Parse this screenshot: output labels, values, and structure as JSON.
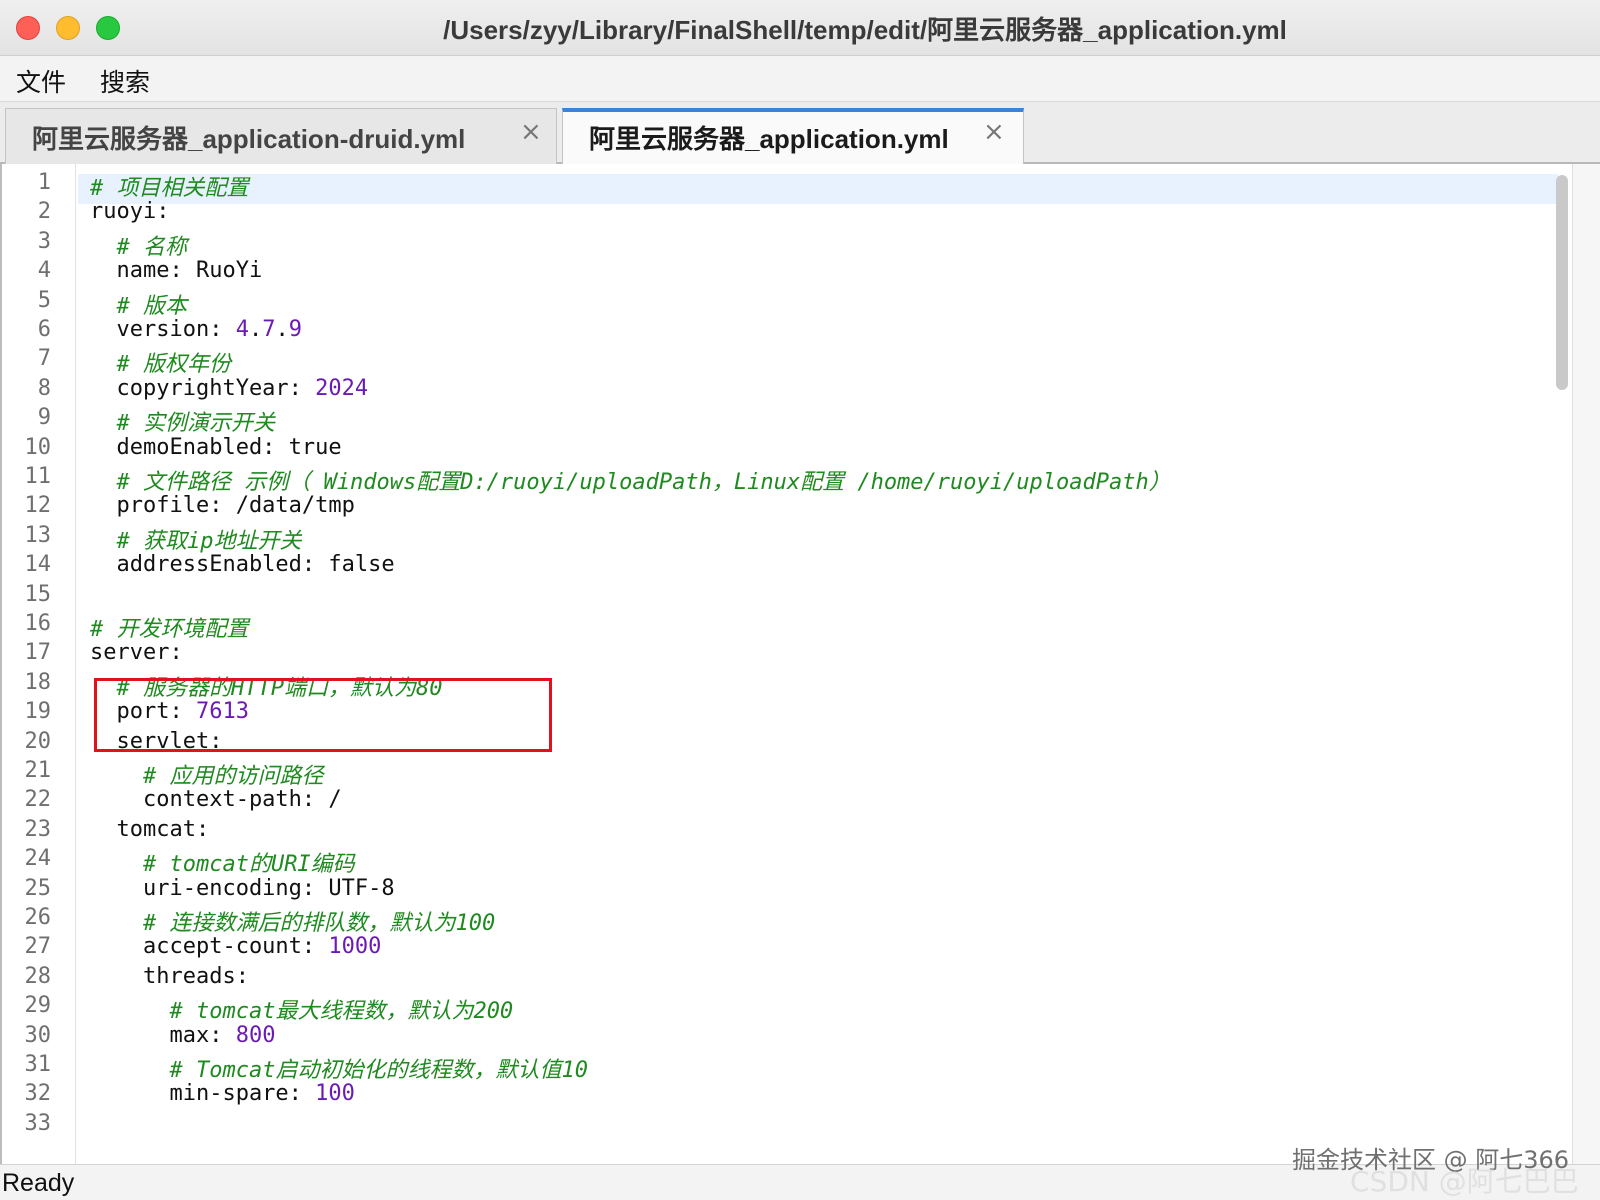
{
  "window": {
    "title": "/Users/zyy/Library/FinalShell/temp/edit/阿里云服务器_application.yml"
  },
  "menu": {
    "items": [
      "文件",
      "搜索"
    ]
  },
  "tabs": [
    {
      "label": "阿里云服务器_application-druid.yml",
      "close": "×",
      "active": false
    },
    {
      "label": "阿里云服务器_application.yml",
      "close": "×",
      "active": true
    }
  ],
  "editor": {
    "lines": [
      {
        "n": "1",
        "parts": [
          {
            "t": "# 项目相关配置",
            "c": "cmt"
          }
        ]
      },
      {
        "n": "2",
        "parts": [
          {
            "t": "ruoyi:",
            "c": ""
          }
        ]
      },
      {
        "n": "3",
        "parts": [
          {
            "t": "  ",
            "c": ""
          },
          {
            "t": "# 名称",
            "c": "cmt"
          }
        ]
      },
      {
        "n": "4",
        "parts": [
          {
            "t": "  name: RuoYi",
            "c": ""
          }
        ]
      },
      {
        "n": "5",
        "parts": [
          {
            "t": "  ",
            "c": ""
          },
          {
            "t": "# 版本",
            "c": "cmt"
          }
        ]
      },
      {
        "n": "6",
        "parts": [
          {
            "t": "  version: ",
            "c": ""
          },
          {
            "t": "4",
            "c": "num"
          },
          {
            "t": ".",
            "c": ""
          },
          {
            "t": "7",
            "c": "num"
          },
          {
            "t": ".",
            "c": ""
          },
          {
            "t": "9",
            "c": "num"
          }
        ]
      },
      {
        "n": "7",
        "parts": [
          {
            "t": "  ",
            "c": ""
          },
          {
            "t": "# 版权年份",
            "c": "cmt"
          }
        ]
      },
      {
        "n": "8",
        "parts": [
          {
            "t": "  copyrightYear: ",
            "c": ""
          },
          {
            "t": "2024",
            "c": "num"
          }
        ]
      },
      {
        "n": "9",
        "parts": [
          {
            "t": "  ",
            "c": ""
          },
          {
            "t": "# 实例演示开关",
            "c": "cmt"
          }
        ]
      },
      {
        "n": "10",
        "parts": [
          {
            "t": "  demoEnabled: true",
            "c": ""
          }
        ]
      },
      {
        "n": "11",
        "parts": [
          {
            "t": "  ",
            "c": ""
          },
          {
            "t": "# 文件路径 示例（ Windows配置D:/ruoyi/uploadPath，Linux配置 /home/ruoyi/uploadPath）",
            "c": "cmt"
          }
        ]
      },
      {
        "n": "12",
        "parts": [
          {
            "t": "  profile: /data/tmp",
            "c": ""
          }
        ]
      },
      {
        "n": "13",
        "parts": [
          {
            "t": "  ",
            "c": ""
          },
          {
            "t": "# 获取ip地址开关",
            "c": "cmt"
          }
        ]
      },
      {
        "n": "14",
        "parts": [
          {
            "t": "  addressEnabled: false",
            "c": ""
          }
        ]
      },
      {
        "n": "15",
        "parts": []
      },
      {
        "n": "16",
        "parts": [
          {
            "t": "# 开发环境配置",
            "c": "cmt"
          }
        ]
      },
      {
        "n": "17",
        "parts": [
          {
            "t": "server:",
            "c": ""
          }
        ]
      },
      {
        "n": "18",
        "parts": [
          {
            "t": "  ",
            "c": ""
          },
          {
            "t": "# 服务器的HTTP端口，默认为80",
            "c": "cmt"
          }
        ]
      },
      {
        "n": "19",
        "parts": [
          {
            "t": "  port: ",
            "c": ""
          },
          {
            "t": "7613",
            "c": "num"
          }
        ]
      },
      {
        "n": "20",
        "parts": [
          {
            "t": "  servlet:",
            "c": ""
          }
        ]
      },
      {
        "n": "21",
        "parts": [
          {
            "t": "    ",
            "c": ""
          },
          {
            "t": "# 应用的访问路径",
            "c": "cmt"
          }
        ]
      },
      {
        "n": "22",
        "parts": [
          {
            "t": "    context-path: /",
            "c": ""
          }
        ]
      },
      {
        "n": "23",
        "parts": [
          {
            "t": "  tomcat:",
            "c": ""
          }
        ]
      },
      {
        "n": "24",
        "parts": [
          {
            "t": "    ",
            "c": ""
          },
          {
            "t": "# tomcat的URI编码",
            "c": "cmt"
          }
        ]
      },
      {
        "n": "25",
        "parts": [
          {
            "t": "    uri-encoding: UTF-8",
            "c": ""
          }
        ]
      },
      {
        "n": "26",
        "parts": [
          {
            "t": "    ",
            "c": ""
          },
          {
            "t": "# 连接数满后的排队数，默认为100",
            "c": "cmt"
          }
        ]
      },
      {
        "n": "27",
        "parts": [
          {
            "t": "    accept-count: ",
            "c": ""
          },
          {
            "t": "1000",
            "c": "num"
          }
        ]
      },
      {
        "n": "28",
        "parts": [
          {
            "t": "    threads:",
            "c": ""
          }
        ]
      },
      {
        "n": "29",
        "parts": [
          {
            "t": "      ",
            "c": ""
          },
          {
            "t": "# tomcat最大线程数，默认为200",
            "c": "cmt"
          }
        ]
      },
      {
        "n": "30",
        "parts": [
          {
            "t": "      max: ",
            "c": ""
          },
          {
            "t": "800",
            "c": "num"
          }
        ]
      },
      {
        "n": "31",
        "parts": [
          {
            "t": "      ",
            "c": ""
          },
          {
            "t": "# Tomcat启动初始化的线程数，默认值10",
            "c": "cmt"
          }
        ]
      },
      {
        "n": "32",
        "parts": [
          {
            "t": "      min-spare: ",
            "c": ""
          },
          {
            "t": "100",
            "c": "num"
          }
        ]
      },
      {
        "n": "33",
        "parts": []
      }
    ]
  },
  "status": {
    "text": "Ready"
  },
  "watermarks": [
    "掘金技术社区 @ 阿七366",
    "CSDN @阿七巴巴"
  ],
  "colors": {
    "comment": "#1f8a1f",
    "number": "#6a1bb5",
    "highlight_box": "#e0121e",
    "active_tab_accent": "#3b82d8"
  }
}
